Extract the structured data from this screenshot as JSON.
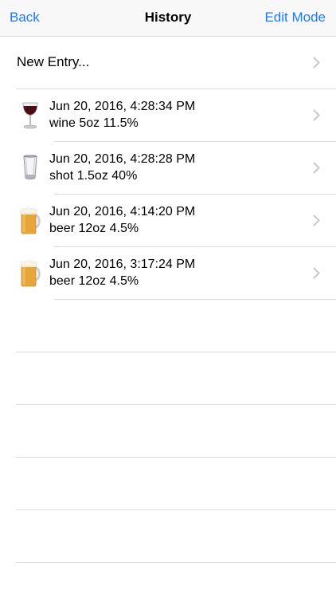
{
  "navbar": {
    "back_label": "Back",
    "title": "History",
    "edit_label": "Edit Mode",
    "accent_color": "#1a7cf5"
  },
  "new_entry": {
    "label": "New Entry..."
  },
  "entries": [
    {
      "icon": "wine-glass-icon",
      "date": "Jun 20, 2016, 4:28:34 PM",
      "desc": "wine 5oz 11.5%"
    },
    {
      "icon": "shot-glass-icon",
      "date": "Jun 20, 2016, 4:28:28 PM",
      "desc": "shot 1.5oz 40%"
    },
    {
      "icon": "beer-mug-icon",
      "date": "Jun 20, 2016, 4:14:20 PM",
      "desc": "beer 12oz 4.5%"
    },
    {
      "icon": "beer-mug-icon",
      "date": "Jun 20, 2016, 3:17:24 PM",
      "desc": "beer 12oz 4.5%"
    }
  ]
}
